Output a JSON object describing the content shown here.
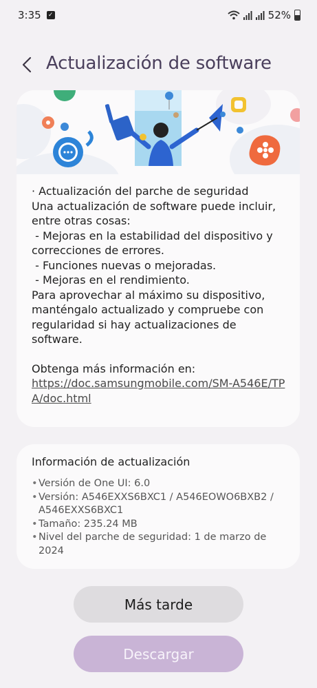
{
  "status_bar": {
    "time": "3:35",
    "battery_text": "52%",
    "battery_level": 0.52,
    "icons": [
      "check-notification-icon",
      "wifi-icon",
      "signal-icon",
      "signal-icon",
      "battery-icon"
    ]
  },
  "header": {
    "back_icon": "chevron-left-icon",
    "title": "Actualización de software"
  },
  "release_notes": {
    "lines": [
      "· Actualización del parche de seguridad",
      "Una actualización de software puede incluir, entre otras cosas:",
      " - Mejoras en la estabilidad del dispositivo y correcciones de errores.",
      " - Funciones nuevas o mejoradas.",
      " - Mejoras en el rendimiento.",
      "Para aprovechar al máximo su dispositivo, manténgalo actualizado y compruebe con regularidad si hay actualizaciones de software."
    ],
    "more_info_label": "Obtenga más información en:",
    "more_info_link": "https://doc.samsungmobile.com/SM-A546E/TPA/doc.html"
  },
  "update_info": {
    "title": "Información de actualización",
    "items": [
      "Versión de One UI: 6.0",
      "Versión: A546EXXS6BXC1 / A546EOWO6BXB2 / A546EXXS6BXC1",
      "Tamaño: 235.24 MB",
      "Nivel del parche de seguridad: 1 de marzo de 2024"
    ]
  },
  "buttons": {
    "later": "Más tarde",
    "download": "Descargar"
  },
  "colors": {
    "background": "#f3f1f4",
    "card": "#fbfafb",
    "title": "#4a3f5c",
    "download_button": "#c9b4d6",
    "later_button": "#dedcdf"
  }
}
